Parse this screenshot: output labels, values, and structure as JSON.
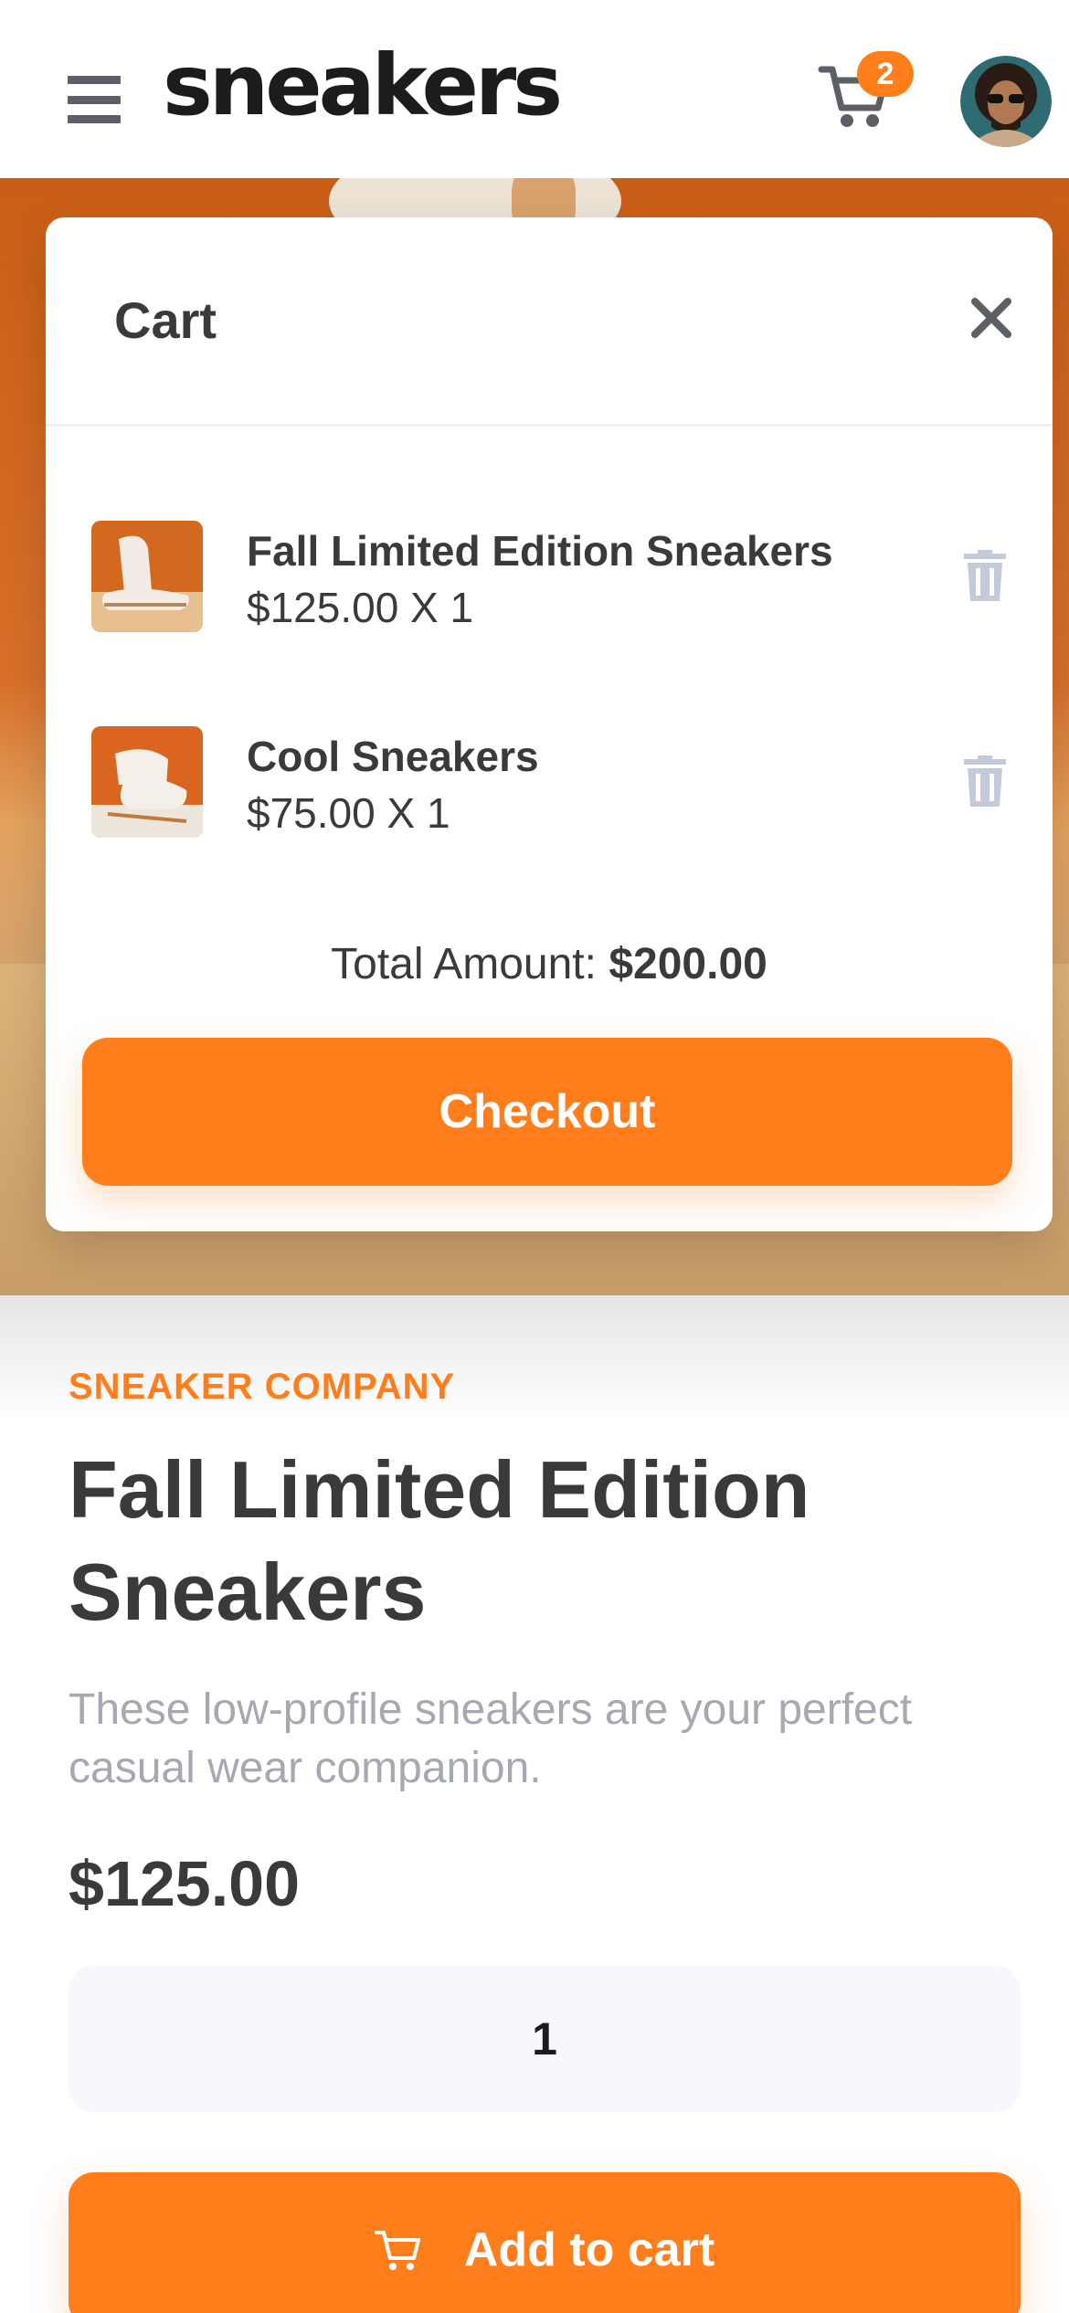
{
  "header": {
    "logo": "sneakers",
    "cart_count": "2"
  },
  "cart": {
    "title": "Cart",
    "items": [
      {
        "name": "Fall Limited Edition Sneakers",
        "price_line": "$125.00 X 1"
      },
      {
        "name": "Cool Sneakers",
        "price_line": "$75.00 X 1"
      }
    ],
    "total_label": "Total Amount:",
    "total_value": "$200.00",
    "checkout_label": "Checkout"
  },
  "product": {
    "company": "SNEAKER COMPANY",
    "title": "Fall Limited Edition Sneakers",
    "description": "These low-profile sneakers are your perfect casual wear companion.",
    "price": "$125.00",
    "quantity": "1",
    "add_to_cart_label": "Add to cart"
  },
  "colors": {
    "accent": "#ff7e1b",
    "text_dark": "#3a3a3d",
    "text_muted": "#a6a9b1",
    "qty_bg": "#f6f8fd"
  },
  "icons": [
    "menu-icon",
    "cart-icon",
    "close-icon",
    "trash-icon",
    "avatar"
  ]
}
